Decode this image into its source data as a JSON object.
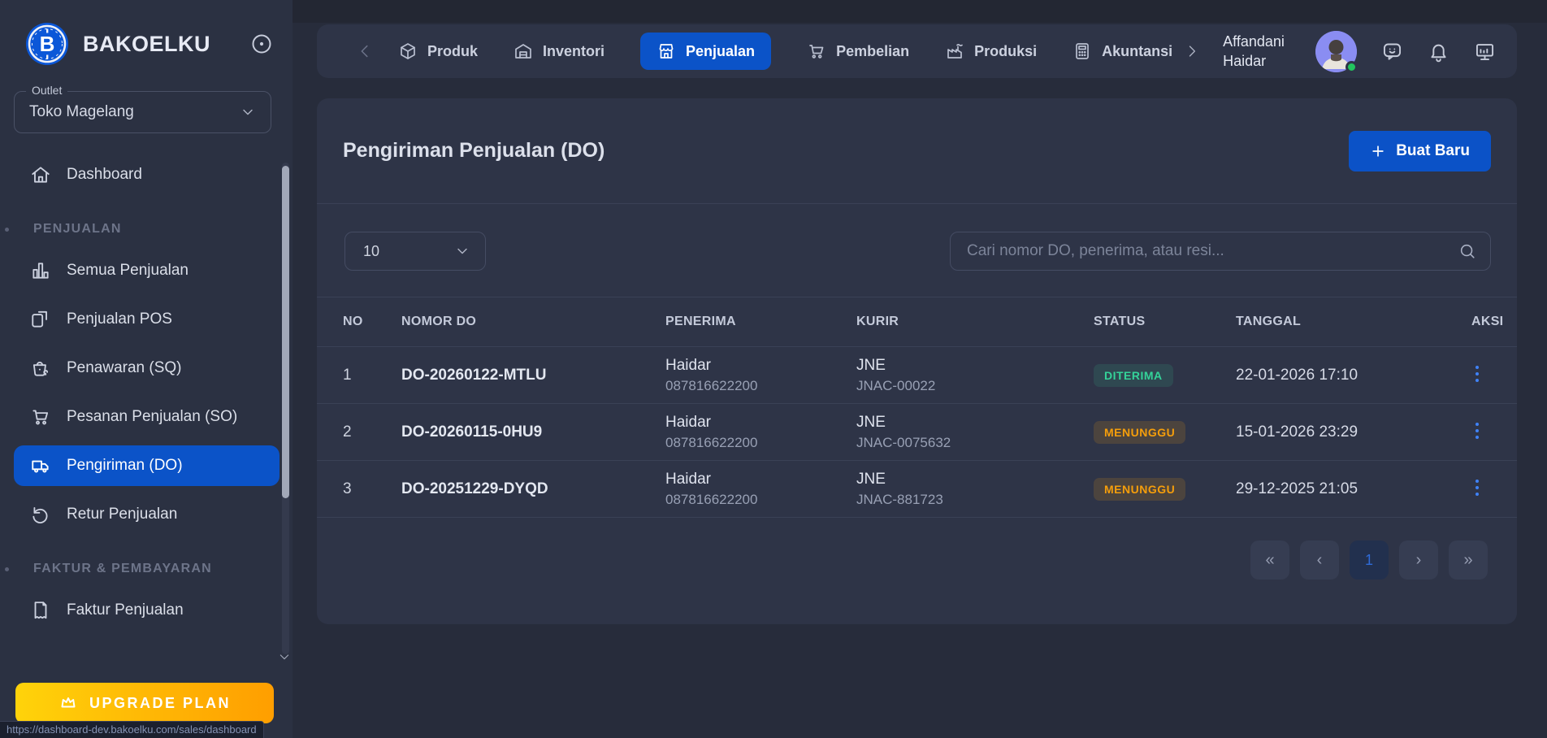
{
  "brand": {
    "name": "BAKOELKU"
  },
  "sidebar": {
    "outlet": {
      "label": "Outlet",
      "value": "Toko Magelang"
    },
    "sections": [
      {
        "label": "PENJUALAN"
      },
      {
        "label": "FAKTUR & PEMBAYARAN"
      }
    ],
    "items": [
      {
        "label": "Dashboard"
      },
      {
        "label": "Semua Penjualan"
      },
      {
        "label": "Penjualan POS"
      },
      {
        "label": "Penawaran (SQ)"
      },
      {
        "label": "Pesanan Penjualan (SO)"
      },
      {
        "label": "Pengiriman (DO)"
      },
      {
        "label": "Retur Penjualan"
      },
      {
        "label": "Faktur Penjualan"
      }
    ],
    "upgrade_button": "UPGRADE PLAN"
  },
  "topnav": {
    "tabs": [
      {
        "label": "Produk"
      },
      {
        "label": "Inventori"
      },
      {
        "label": "Penjualan",
        "active": true
      },
      {
        "label": "Pembelian"
      },
      {
        "label": "Produksi"
      },
      {
        "label": "Akuntansi"
      }
    ],
    "user": {
      "line1": "Affandani",
      "line2": "Haidar"
    }
  },
  "page": {
    "title": "Pengiriman Penjualan (DO)",
    "create_button": "Buat Baru",
    "page_size": "10",
    "search_placeholder": "Cari nomor DO, penerima, atau resi...",
    "table": {
      "headers": [
        "NO",
        "NOMOR DO",
        "PENERIMA",
        "KURIR",
        "STATUS",
        "TANGGAL",
        "AKSI"
      ],
      "rows": [
        {
          "no": "1",
          "nomor_do": "DO-20260122-MTLU",
          "penerima_nama": "Haidar",
          "penerima_telp": "087816622200",
          "kurir_nama": "JNE",
          "kurir_resi": "JNAC-00022",
          "status": "DITERIMA",
          "tanggal": "22-01-2026 17:10"
        },
        {
          "no": "2",
          "nomor_do": "DO-20260115-0HU9",
          "penerima_nama": "Haidar",
          "penerima_telp": "087816622200",
          "kurir_nama": "JNE",
          "kurir_resi": "JNAC-0075632",
          "status": "MENUNGGU",
          "tanggal": "15-01-2026 23:29"
        },
        {
          "no": "3",
          "nomor_do": "DO-20251229-DYQD",
          "penerima_nama": "Haidar",
          "penerima_telp": "087816622200",
          "kurir_nama": "JNE",
          "kurir_resi": "JNAC-881723",
          "status": "MENUNGGU",
          "tanggal": "29-12-2025 21:05"
        }
      ]
    },
    "pagination": {
      "first": "«",
      "prev": "‹",
      "current": "1",
      "next": "›",
      "last": "»"
    }
  },
  "statusbar": {
    "url": "https://dashboard-dev.bakoelku.com/sales/dashboard"
  },
  "colors": {
    "accent": "#0b53c8",
    "status_diterima": "#34d399",
    "status_menunggu": "#f59e0b",
    "upgrade_gradient_from": "#ffd30a",
    "upgrade_gradient_to": "#ff9e00",
    "sidebar_bg": "#2b3142",
    "panel_bg": "#2e3447"
  }
}
